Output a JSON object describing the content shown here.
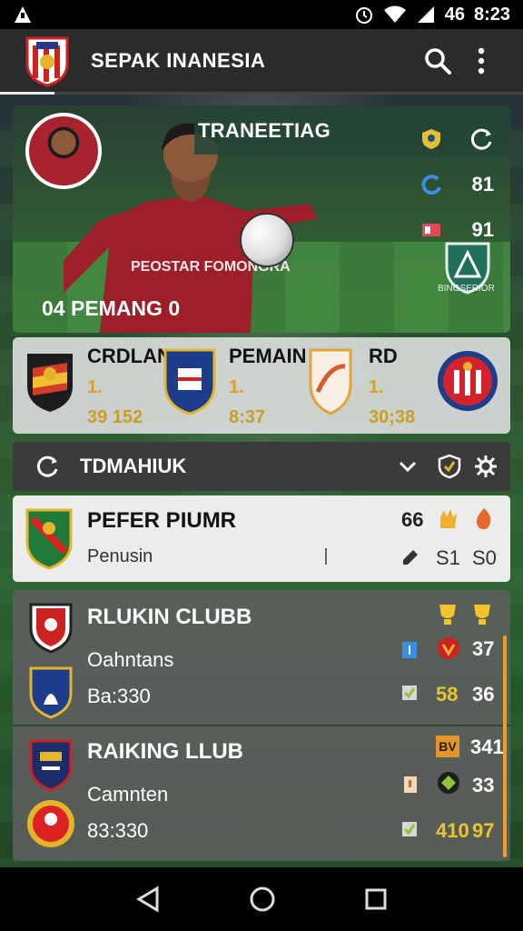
{
  "status_bar": {
    "time": "8:23",
    "network": "46"
  },
  "app_bar": {
    "title": "SEPAK INANESIA"
  },
  "hero": {
    "panel_title": "TRANEETIAG",
    "stats": [
      {
        "icon": "shield-icon",
        "value": ""
      },
      {
        "icon": "cycle-icon",
        "value": ""
      },
      {
        "icon": "speed-icon",
        "value": "81"
      },
      {
        "icon": "card-icon",
        "value": "91"
      }
    ],
    "badge_text": "BINGSERIOR",
    "caption": "04 PEMANG 0",
    "jersey_text": "PEOSTAR FOMONGRA"
  },
  "clubs_strip": [
    {
      "name": "CRDLAN",
      "rank": "1.",
      "score": "39 152"
    },
    {
      "name": "PEMAIN",
      "rank": "1.",
      "score": "8:37"
    },
    {
      "name": "RD",
      "rank": "1.",
      "score": "30;38"
    }
  ],
  "section": {
    "label": "TDMAHIUK"
  },
  "player_card": {
    "name": "PEFER PIUMR",
    "role": "Penusin",
    "top_value": "66",
    "stat_a": "S1",
    "stat_b": "S0"
  },
  "list": [
    {
      "title": "RLUKIN CLUBB",
      "subtitle": "Oahntans",
      "detail": "Ba:330",
      "values": {
        "v1": "37",
        "v2": "58",
        "v3": "36"
      }
    },
    {
      "title": "RAIKING LLUB",
      "subtitle": "Camnten",
      "detail": "83:330",
      "values": {
        "v0": "341",
        "v1": "33",
        "v2": "410",
        "v3": "97"
      }
    }
  ],
  "colors": {
    "accent": "#f39b27",
    "gold": "#d9a31a",
    "jersey": "#a8232d"
  }
}
